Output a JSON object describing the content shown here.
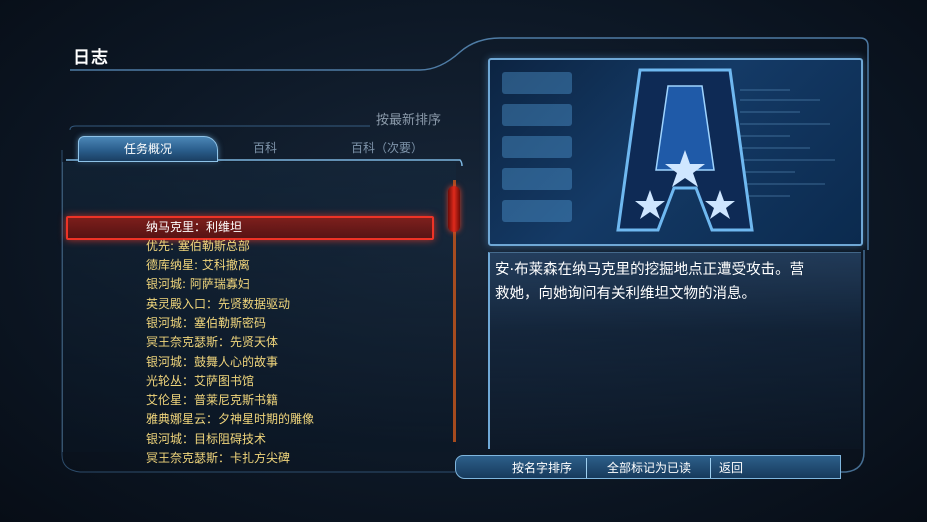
{
  "page": {
    "title": "日志",
    "sort_latest": "按最新排序"
  },
  "tabs": [
    {
      "label": "任务概况",
      "active": true
    },
    {
      "label": "百科",
      "active": false
    },
    {
      "label": "百科（次要）",
      "active": false
    }
  ],
  "list": {
    "selected_index": 0,
    "items": [
      "纳马克里：利维坦",
      "优先: 塞伯勒斯总部",
      "德库纳星: 艾科撤离",
      "银河城: 阿萨瑞寡妇",
      "英灵殿入口：先贤数据驱动",
      "银河城：塞伯勒斯密码",
      "冥王奈克瑟斯：先贤天体",
      "银河城：鼓舞人心的故事",
      "光轮丛：艾萨图书馆",
      "艾伦星：普莱尼克斯书籍",
      "雅典娜星云：夕神星时期的雕像",
      "银河城：目标阻碍技术",
      "冥王奈克瑟斯：卡扎方尖碑"
    ]
  },
  "image": {
    "icon": "alliance-emblem-icon"
  },
  "description": "安·布莱森在纳马克里的挖掘地点正遭受攻击。营救她，向她询问有关利维坦文物的消息。",
  "buttons": {
    "sort_name": "按名字排序",
    "mark_all_read": "全部标记为已读",
    "back": "返回"
  },
  "colors": {
    "accent_blue": "#6fa8d6",
    "selection_red": "#ee3326",
    "list_text": "#f1d67c"
  }
}
